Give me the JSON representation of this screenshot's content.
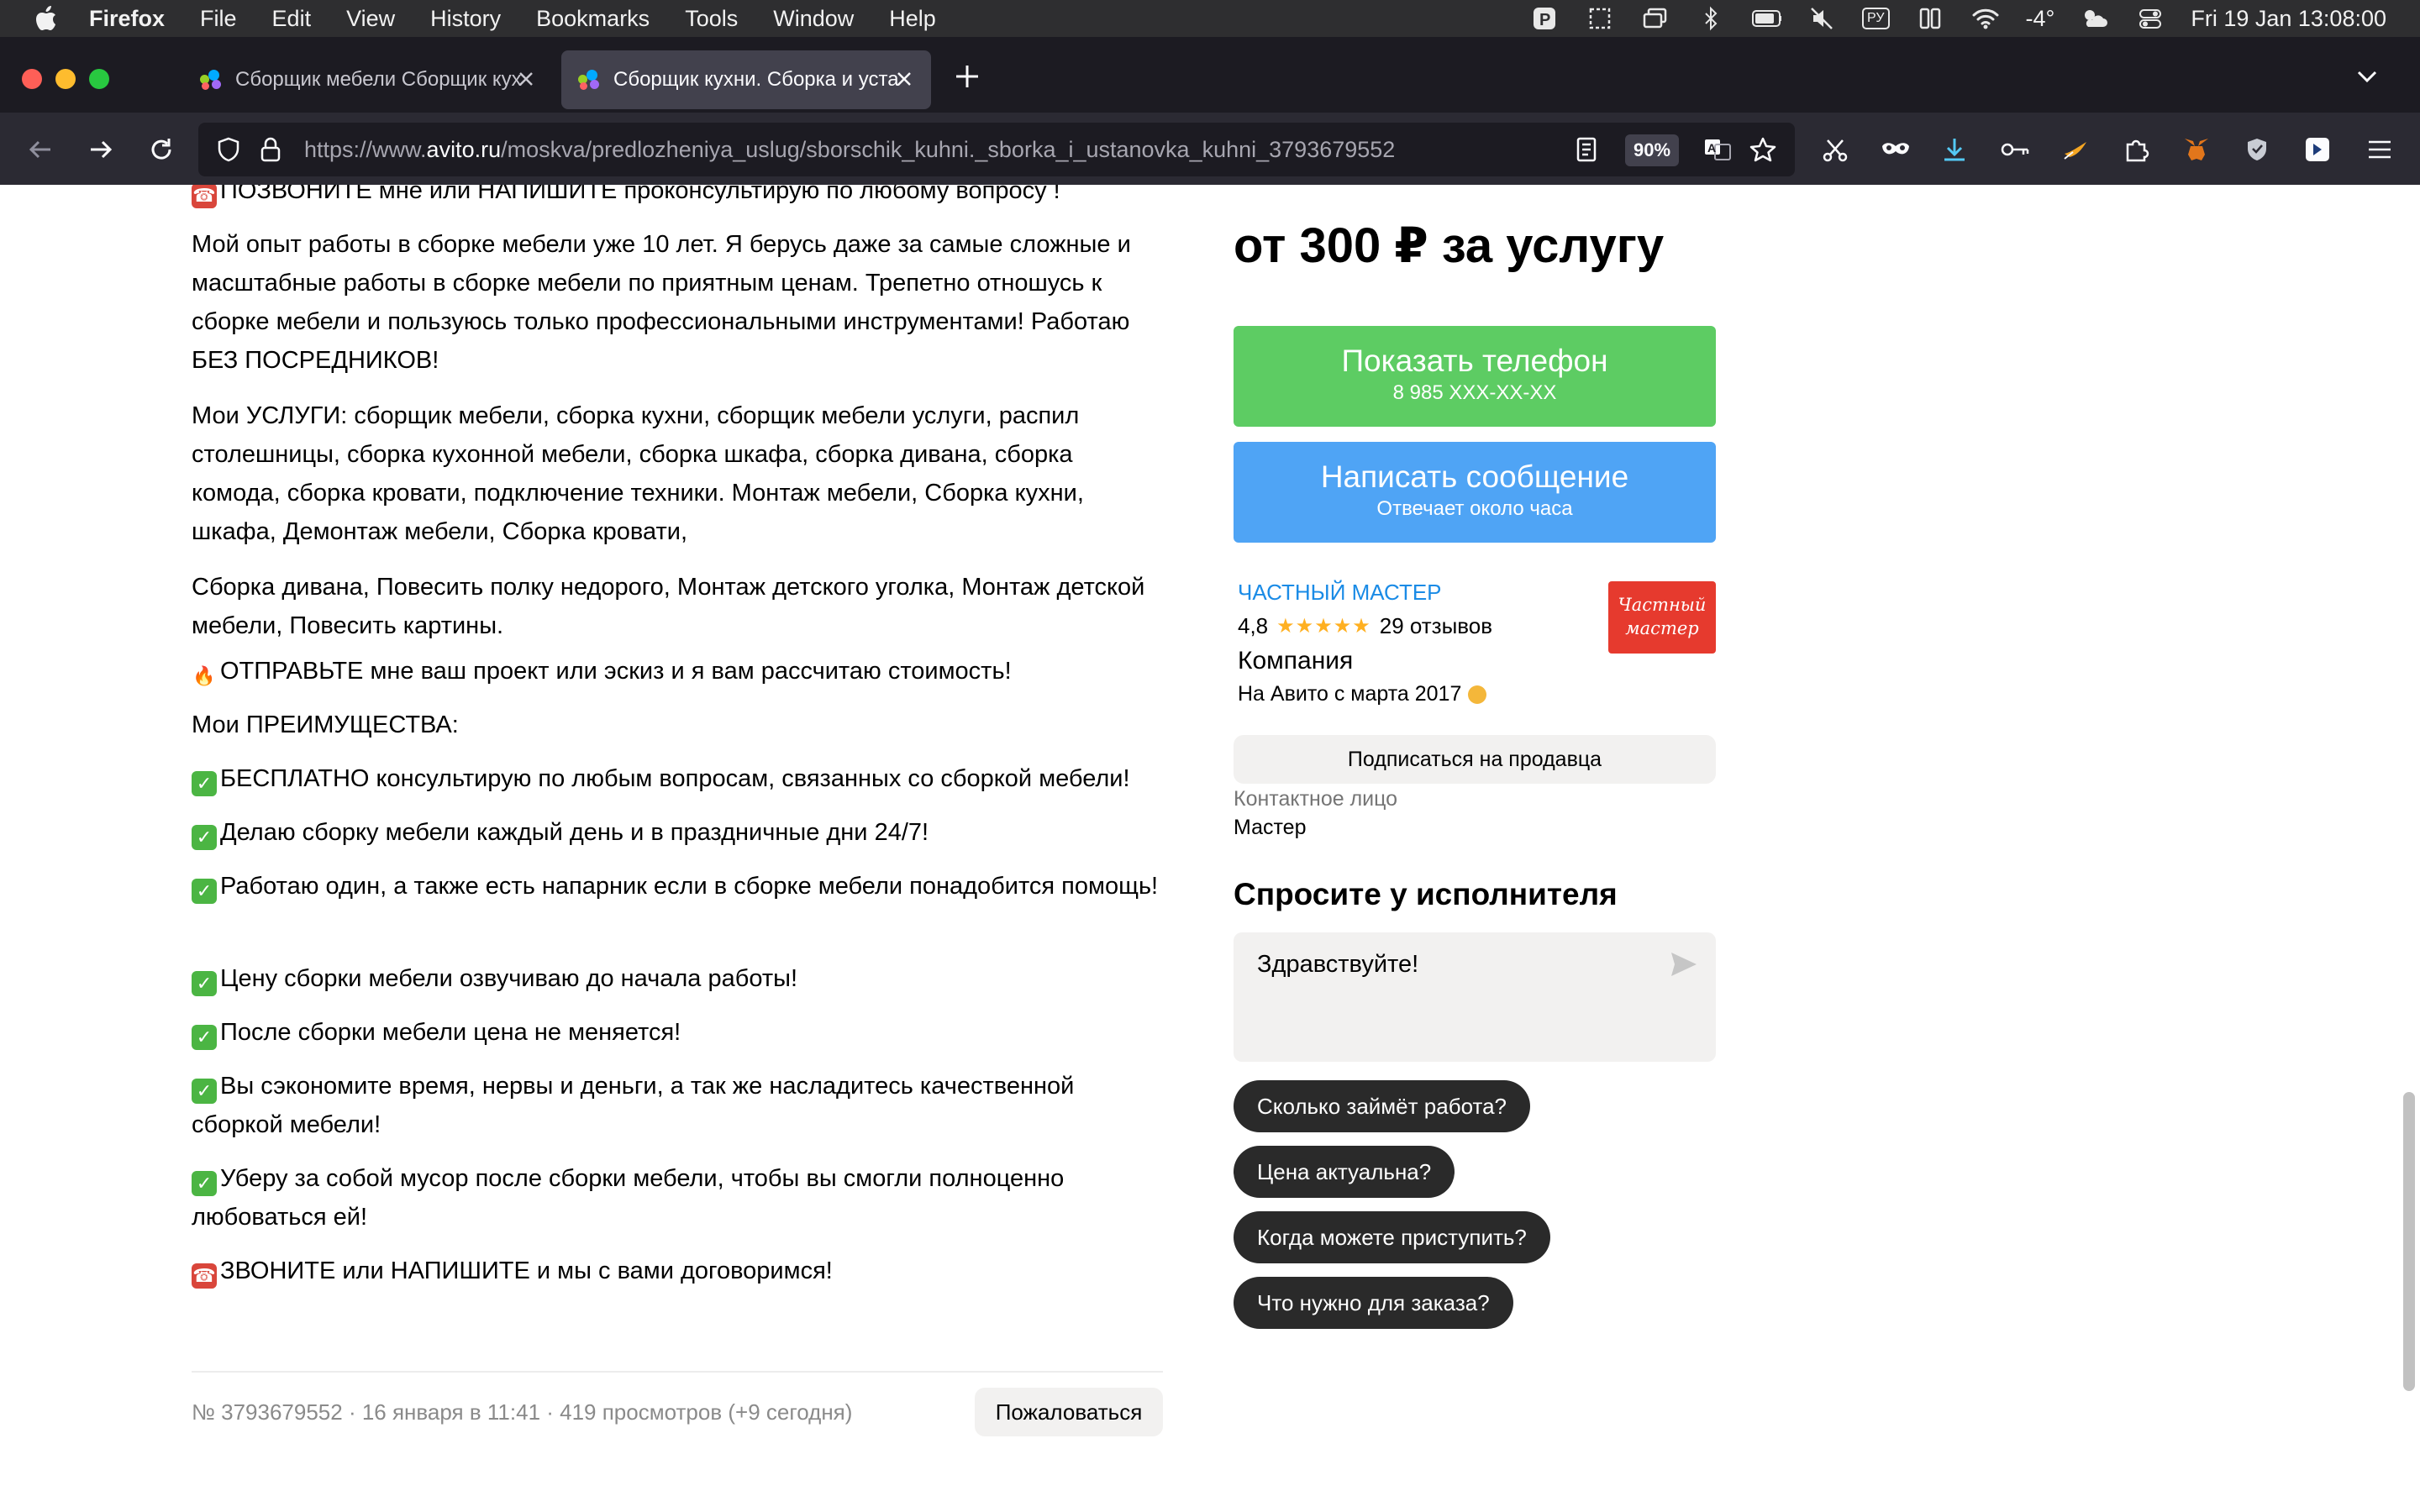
{
  "menubar": {
    "app_name": "Firefox",
    "items": [
      "File",
      "Edit",
      "View",
      "History",
      "Bookmarks",
      "Tools",
      "Window",
      "Help"
    ],
    "keyboard_layout": "РУ",
    "temperature": "-4°",
    "datetime": "Fri 19 Jan  13:08:00"
  },
  "tabs": [
    {
      "title": "Сборщик мебели Сборщик кух"
    },
    {
      "title": "Сборщик кухни. Сборка и уста"
    }
  ],
  "navbar": {
    "url_prefix": "https://www.",
    "url_host": "avito.ru",
    "url_path": "/moskva/predlozheniya_uslug/sborschik_kuhni._sborka_i_ustanovka_kuhni_3793679552",
    "zoom": "90%"
  },
  "description": {
    "p0": "ПОЗВОНИТЕ мне или НАПИШИТЕ проконсультирую по любому вопросу !",
    "p1": "Мой опыт работы в сборке мебели уже 10 лет. Я берусь даже за самые сложные и масштабные работы в сборке мебели по приятным ценам. Трепетно отношусь к сборке мебели и пользуюсь только профессиональными инструментами! Работаю БЕЗ ПОСРЕДНИКОВ!",
    "p2": "Мои УСЛУГИ: сборщик мебели, сборка кухни, сборщик мебели услуги, распил столешницы, сборка кухонной мебели, сборка шкафа, сборка дивана, сборка комода, сборка кровати, подключение техники. Монтаж мебели, Сборка кухни, шкафа, Демонтаж мебели, Сборка кровати,",
    "p3": "Сборка дивана, Повесить полку недорого, Монтаж детского уголка, Монтаж детской мебели, Повесить картины.",
    "p4": "ОТПРАВЬТЕ мне ваш проект или эскиз и я вам рассчитаю стоимость!",
    "p5": "Мои ПРЕИМУЩЕСТВА:",
    "p6": "БЕСПЛАТНО консультирую по любым вопросам, связанных со сборкой мебели!",
    "p7": "Делаю сборку мебели каждый день и в праздничные дни 24/7!",
    "p8": "Работаю один, а также есть напарник если в сборке мебели понадобится помощь!",
    "p9": "Цену сборки мебели озвучиваю до начала работы!",
    "p10": "После сборки мебели цена не меняется!",
    "p11": "Вы сэкономите время, нервы и деньги, а так же насладитесь качественной сборкой мебели!",
    "p12": "Уберу за собой мусор после сборки мебели, чтобы вы смогли полноценно любоваться ей!",
    "p13": "ЗВОНИТЕ или НАПИШИТЕ и мы с вами договоримся!"
  },
  "footer": {
    "meta": "№ 3793679552 · 16 января в 11:41 · 419 просмотров (+9 сегодня)",
    "report_label": "Пожаловаться"
  },
  "sidebar": {
    "price": "от 300 ₽ за услугу",
    "phone_button": {
      "label": "Показать телефон",
      "sub": "8 985 XXX-XX-XX"
    },
    "message_button": {
      "label": "Написать сообщение",
      "sub": "Отвечает около часа"
    },
    "seller_type": "ЧАСТНЫЙ МАСТЕР",
    "rating_value": "4,8",
    "rating_stars": 4.8,
    "reviews": "29 отзывов",
    "seller_name": "Компания",
    "since": "На Авито с марта 2017",
    "avatar_text": "Частный мастер",
    "subscribe_label": "Подписаться на продавца",
    "contact_label": "Контактное лицо",
    "contact_value": "Мастер",
    "ask_heading": "Спросите у исполнителя",
    "ask_text": "Здравствуйте!",
    "quick_questions": [
      "Сколько займёт работа?",
      "Цена актуальна?",
      "Когда можете приступить?",
      "Что нужно для заказа?"
    ]
  },
  "colors": {
    "phone_button": "#5dcc63",
    "message_button": "#4fa4f5",
    "seller_link": "#1a8be6",
    "avatar_bg": "#e63a2e",
    "star": "#ffb021"
  }
}
